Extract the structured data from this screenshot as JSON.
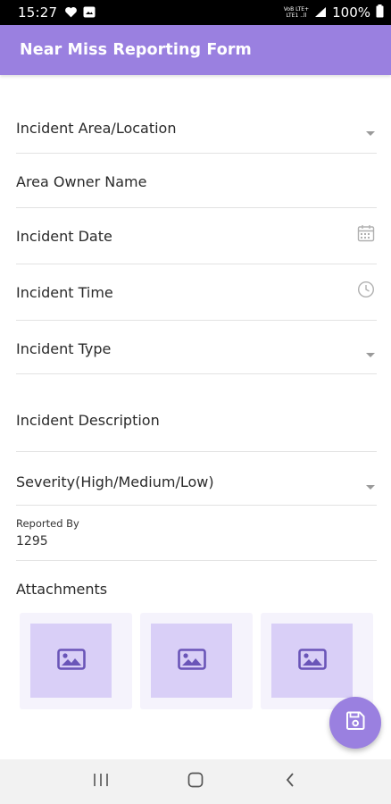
{
  "status_bar": {
    "time": "15:27",
    "network_line1": "VoB LTE+",
    "network_line2": "LTE1 ..ll",
    "battery": "100%"
  },
  "app_bar": {
    "title": "Near Miss Reporting Form"
  },
  "form": {
    "fields": [
      {
        "label": "Incident Area/Location",
        "icon": "dropdown-arrow-icon"
      },
      {
        "label": "Area Owner Name"
      },
      {
        "label": "Incident Date",
        "icon": "calendar-icon"
      },
      {
        "label": "Incident Time",
        "icon": "clock-icon"
      },
      {
        "label": "Incident Type",
        "icon": "dropdown-arrow-icon"
      },
      {
        "label": "Incident Description"
      },
      {
        "label": "Severity(High/Medium/Low)",
        "icon": "dropdown-arrow-icon"
      }
    ],
    "reported_by": {
      "label": "Reported By",
      "value": "1295"
    },
    "attachments": {
      "label": "Attachments",
      "tiles": [
        {
          "icon": "image-icon"
        },
        {
          "icon": "image-icon"
        },
        {
          "icon": "image-icon"
        }
      ]
    }
  },
  "fab": {
    "icon": "save-icon"
  },
  "colors": {
    "primary": "#9a80e0",
    "tile_bg": "#f5f3fc",
    "tile_inner": "#d9cff7",
    "icon_purple": "#6a55b8"
  },
  "nav_bar": {
    "buttons": [
      "recent-apps-icon",
      "home-icon",
      "back-icon"
    ]
  }
}
